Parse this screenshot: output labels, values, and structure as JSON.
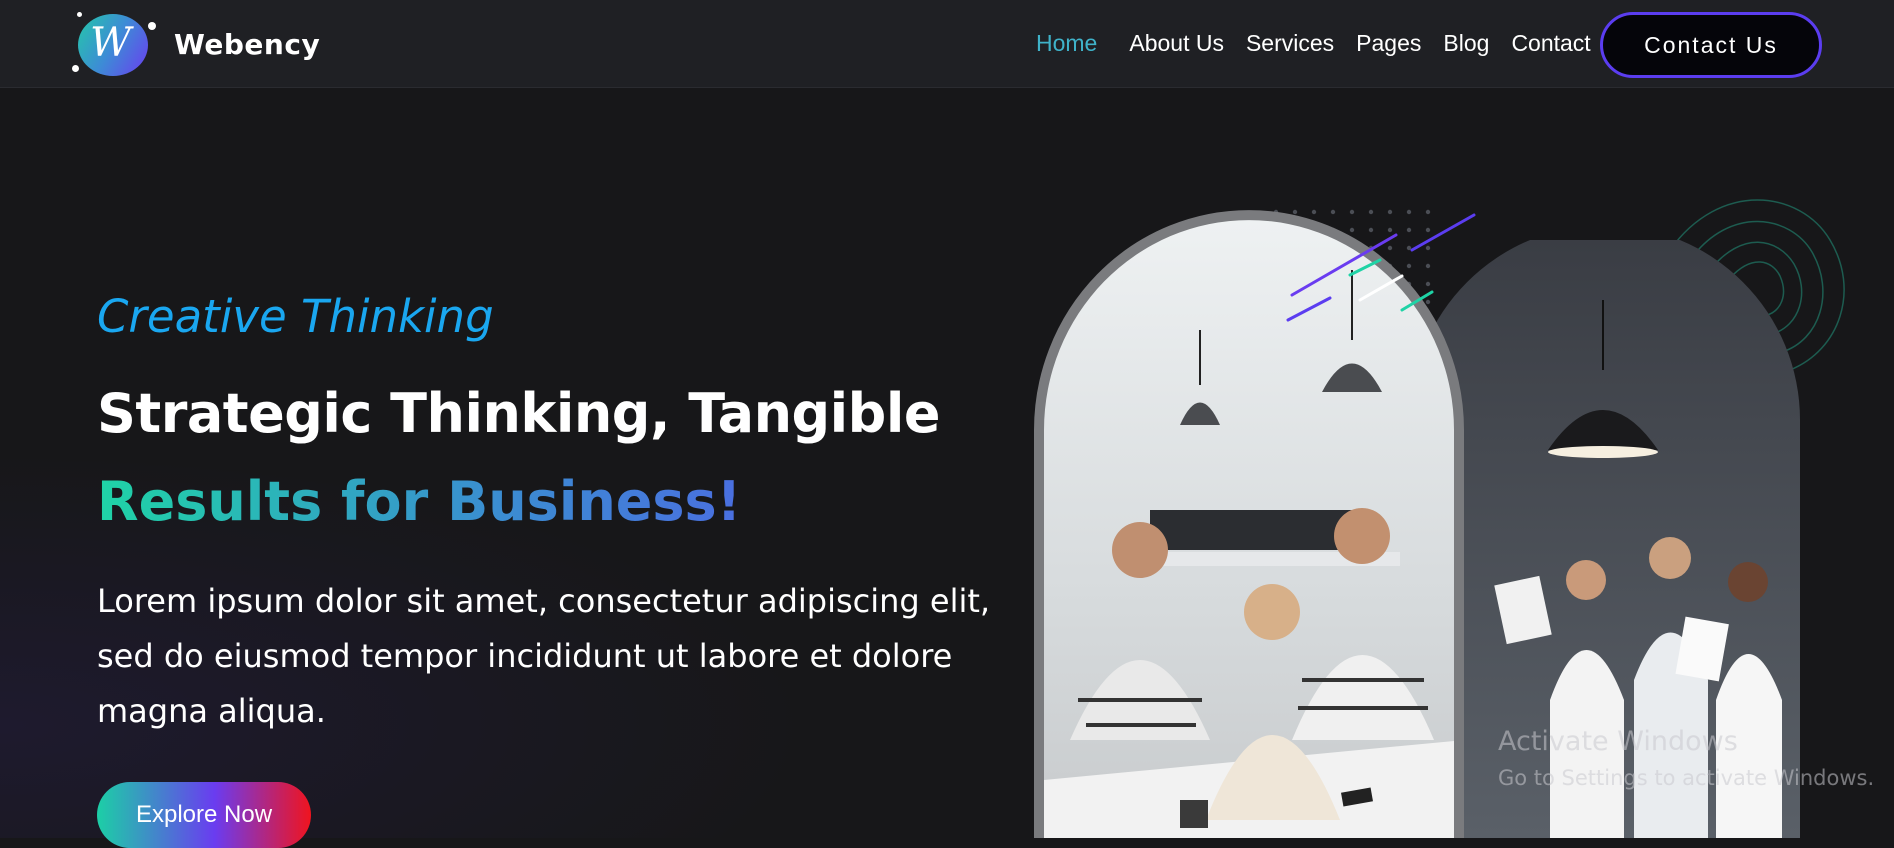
{
  "brand": {
    "name": "Webency",
    "logo_letter": "W"
  },
  "nav": {
    "items": [
      {
        "label": "Home",
        "active": true
      },
      {
        "label": "About Us",
        "active": false
      },
      {
        "label": "Services",
        "active": false
      },
      {
        "label": "Pages",
        "active": false
      },
      {
        "label": "Blog",
        "active": false
      },
      {
        "label": "Contact",
        "active": false
      }
    ],
    "cta_label": "Contact Us"
  },
  "hero": {
    "eyebrow": "Creative Thinking",
    "title_line1": "Strategic Thinking, Tangible",
    "title_line2": "Results for Business!",
    "lead": "Lorem ipsum dolor sit amet, consectetur adipiscing elit, sed do eiusmod tempor incididunt ut labore et dolore magna aliqua.",
    "button_label": "Explore Now"
  },
  "overlay": {
    "watermark_title": "Activate Windows",
    "watermark_sub": "Go to Settings to activate Windows."
  },
  "colors": {
    "background": "#171719",
    "header": "#1f2024",
    "accent_teal": "#1fd3a6",
    "accent_blue": "#1aa7f0",
    "accent_purple": "#5b3df0",
    "accent_red": "#f0141e",
    "nav_active": "#3fb2c9"
  },
  "icons": [
    "logo-icon",
    "dot-grid-decor",
    "contour-decor",
    "line-streak-decor"
  ]
}
